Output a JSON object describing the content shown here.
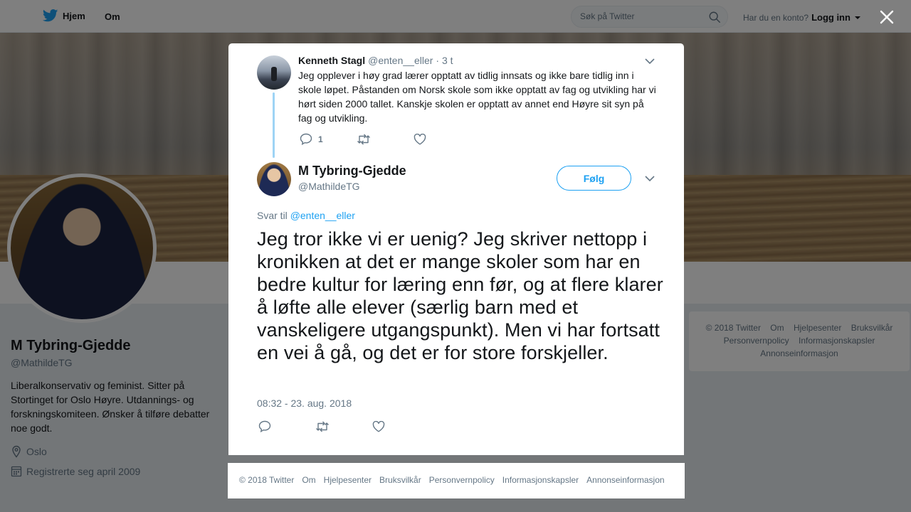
{
  "topbar": {
    "home_label": "Hjem",
    "about_label": "Om",
    "search_placeholder": "Søk på Twitter",
    "account_prompt": "Har du en konto?",
    "login_label": "Logg inn"
  },
  "profile": {
    "name": "M Tybring-Gjedde",
    "handle": "@MathildeTG",
    "bio": "Liberalkonservativ og feminist. Sitter på Stortinget for Oslo Høyre. Utdannings- og forskningskomiteen. Ønsker å tilføre debatter noe godt.",
    "location": "Oslo",
    "joined": "Registrerte seg april 2009"
  },
  "side_footer": {
    "items": [
      "© 2018 Twitter",
      "Om",
      "Hjelpesenter",
      "Bruksvilkår",
      "Personvernpolicy",
      "Informasjonskapsler",
      "Annonseinformasjon"
    ]
  },
  "parent_tweet": {
    "name": "Kenneth Stagl",
    "handle": "@enten__eller",
    "time": "· 3 t",
    "text": "Jeg opplever i høy grad lærer opptatt av tidlig innsats og ikke bare tidlig inn i skole løpet. Påstanden om Norsk skole som ikke opptatt av fag og utvikling har vi hørt siden 2000 tallet. Kanskje skolen er opptatt av annet end Høyre sit syn på fag og utvikling.",
    "reply_count": "1"
  },
  "main_tweet": {
    "name": "M Tybring-Gjedde",
    "handle": "@MathildeTG",
    "follow_label": "Følg",
    "reply_prefix": "Svar til",
    "reply_to": "@enten__eller",
    "text": "Jeg tror ikke vi er uenig? Jeg skriver nettopp i kronikken at det er mange skoler som har en bedre kultur for læring enn før, og at flere klarer å løfte alle elever (særlig barn med et vanskeligere utgangspunkt). Men vi har fortsatt en vei å gå, og det er for store forskjeller.",
    "timestamp": "08:32 - 23. aug. 2018"
  },
  "modal_footer": {
    "items": [
      "© 2018 Twitter",
      "Om",
      "Hjelpesenter",
      "Bruksvilkår",
      "Personvernpolicy",
      "Informasjonskapsler",
      "Annonseinformasjon"
    ]
  },
  "icons": {
    "brand": "twitter-bird-icon",
    "search": "search-icon",
    "close": "close-icon",
    "location": "location-pin-icon",
    "calendar": "calendar-icon",
    "reply": "reply-icon",
    "retweet": "retweet-icon",
    "like": "heart-icon",
    "more": "chevron-down-icon"
  },
  "colors": {
    "accent": "#1da1f2",
    "thread_line": "#9ed4f5",
    "muted_text": "#657786",
    "overlay": "rgba(0,0,0,0.5)"
  }
}
